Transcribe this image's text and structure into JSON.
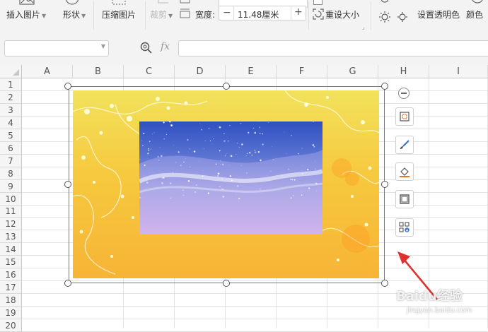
{
  "ribbon": {
    "insert_picture": "插入图片",
    "shape": "形状",
    "compress_picture": "压缩图片",
    "crop": "裁剪",
    "width_label": "宽度:",
    "width_value": "11.48厘米",
    "minus": "−",
    "plus": "+",
    "reset_size": "重设大小",
    "set_transparent": "设置透明色",
    "color": "颜色"
  },
  "formula_bar": {
    "fx": "fx"
  },
  "columns": [
    "A",
    "B",
    "C",
    "D",
    "E",
    "F",
    "G",
    "H",
    "I"
  ],
  "rows": [
    "1",
    "2",
    "3",
    "4",
    "5",
    "6",
    "7",
    "8",
    "9",
    "10",
    "11",
    "12",
    "13",
    "14",
    "15",
    "16",
    "17",
    "18",
    "19",
    "20"
  ],
  "watermark": {
    "text": "Baidu经验",
    "sub": "jingyan.baidu.com"
  },
  "colors": {
    "ribbon_bg": "#f3f3f3",
    "header_bg": "#f5f5f5",
    "gridline": "#e3e3e3",
    "arrow": "#e03030",
    "picture_yellow": "#f2e25c",
    "picture_orange": "#f7b436",
    "inner_blue": "#2f50c0",
    "inner_lavender": "#c9a9e6"
  },
  "icons": [
    "insert-picture-icon",
    "shape-icon",
    "compress-icon",
    "crop-icon",
    "zoom-icon",
    "collapse-icon",
    "crop-float-icon",
    "brush-icon",
    "fill-icon",
    "border-icon",
    "layout-icon",
    "arrow-annotation"
  ]
}
